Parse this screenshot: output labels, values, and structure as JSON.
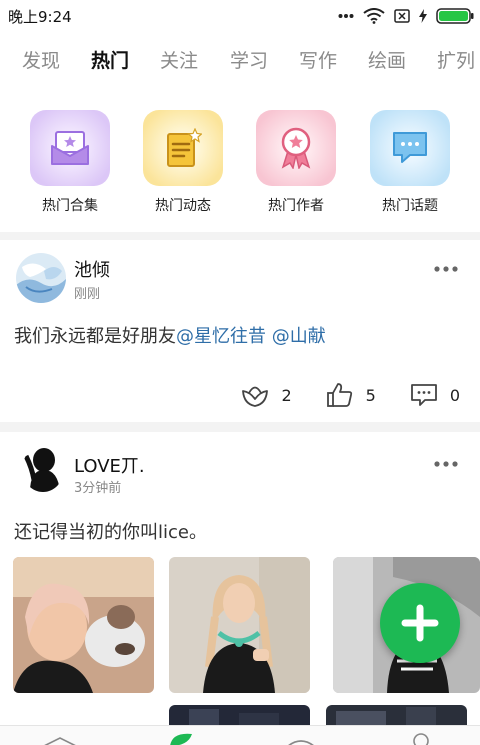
{
  "status_bar": {
    "time": "晚上9:24",
    "icons": [
      "more-dots-icon",
      "wifi-icon",
      "sim-slot-icon",
      "charging-icon",
      "battery-icon"
    ],
    "battery_color": "#26c645"
  },
  "tabs": [
    {
      "label": "发现",
      "active": false
    },
    {
      "label": "热门",
      "active": true
    },
    {
      "label": "关注",
      "active": false
    },
    {
      "label": "学习",
      "active": false
    },
    {
      "label": "写作",
      "active": false
    },
    {
      "label": "绘画",
      "active": false
    },
    {
      "label": "扩列",
      "active": false
    }
  ],
  "categories": [
    {
      "label": "热门合集",
      "icon": "envelope-star-icon",
      "color": "#b48be8"
    },
    {
      "label": "热门动态",
      "icon": "notepad-star-icon",
      "color": "#f0c23a"
    },
    {
      "label": "热门作者",
      "icon": "award-ribbon-icon",
      "color": "#f07e99"
    },
    {
      "label": "热门话题",
      "icon": "chat-bubble-icon",
      "color": "#58b3ec"
    }
  ],
  "posts": [
    {
      "author": "池倾",
      "time": "刚刚",
      "text": "我们永远都是好朋友",
      "mentions": [
        "@星忆往昔",
        "@山献"
      ],
      "flower_count": "2",
      "like_count": "5",
      "comment_count": "0"
    },
    {
      "author": "LOVE丌.",
      "time": "3分钟前",
      "text": "还记得当初的你叫lice。"
    }
  ],
  "fab": {
    "icon": "plus-icon",
    "color": "#1db954"
  },
  "more_icon": "more-dots-icon"
}
